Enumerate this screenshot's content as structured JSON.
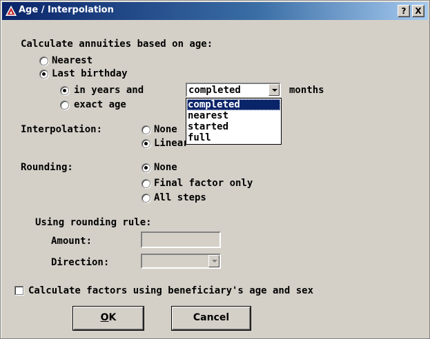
{
  "window": {
    "title": "Age / Interpolation",
    "help_button": "?",
    "close_button": "X"
  },
  "age": {
    "heading": "Calculate annuities based on age:",
    "nearest_label": "Nearest",
    "last_birthday_label": "Last birthday",
    "in_years_label": "in years and",
    "months_label": "months",
    "exact_age_label": "exact age",
    "selected": "Last birthday",
    "sub_selected": "in years and",
    "months_combo": {
      "value": "completed",
      "options": [
        "completed",
        "nearest",
        "started",
        "full"
      ],
      "expanded": true
    }
  },
  "interpolation": {
    "label": "Interpolation:",
    "options": [
      "None",
      "Linear"
    ],
    "selected": "Linear"
  },
  "rounding": {
    "label": "Rounding:",
    "options": [
      "None",
      "Final factor only",
      "All steps"
    ],
    "selected": "None",
    "rule_heading": "Using rounding rule:",
    "amount_label": "Amount:",
    "amount_value": "",
    "direction_label": "Direction:",
    "direction_value": ""
  },
  "beneficiary": {
    "label": "Calculate factors using beneficiary's age and sex",
    "checked": false
  },
  "buttons": {
    "ok_mnemonic": "O",
    "ok_rest": "K",
    "cancel": "Cancel"
  }
}
